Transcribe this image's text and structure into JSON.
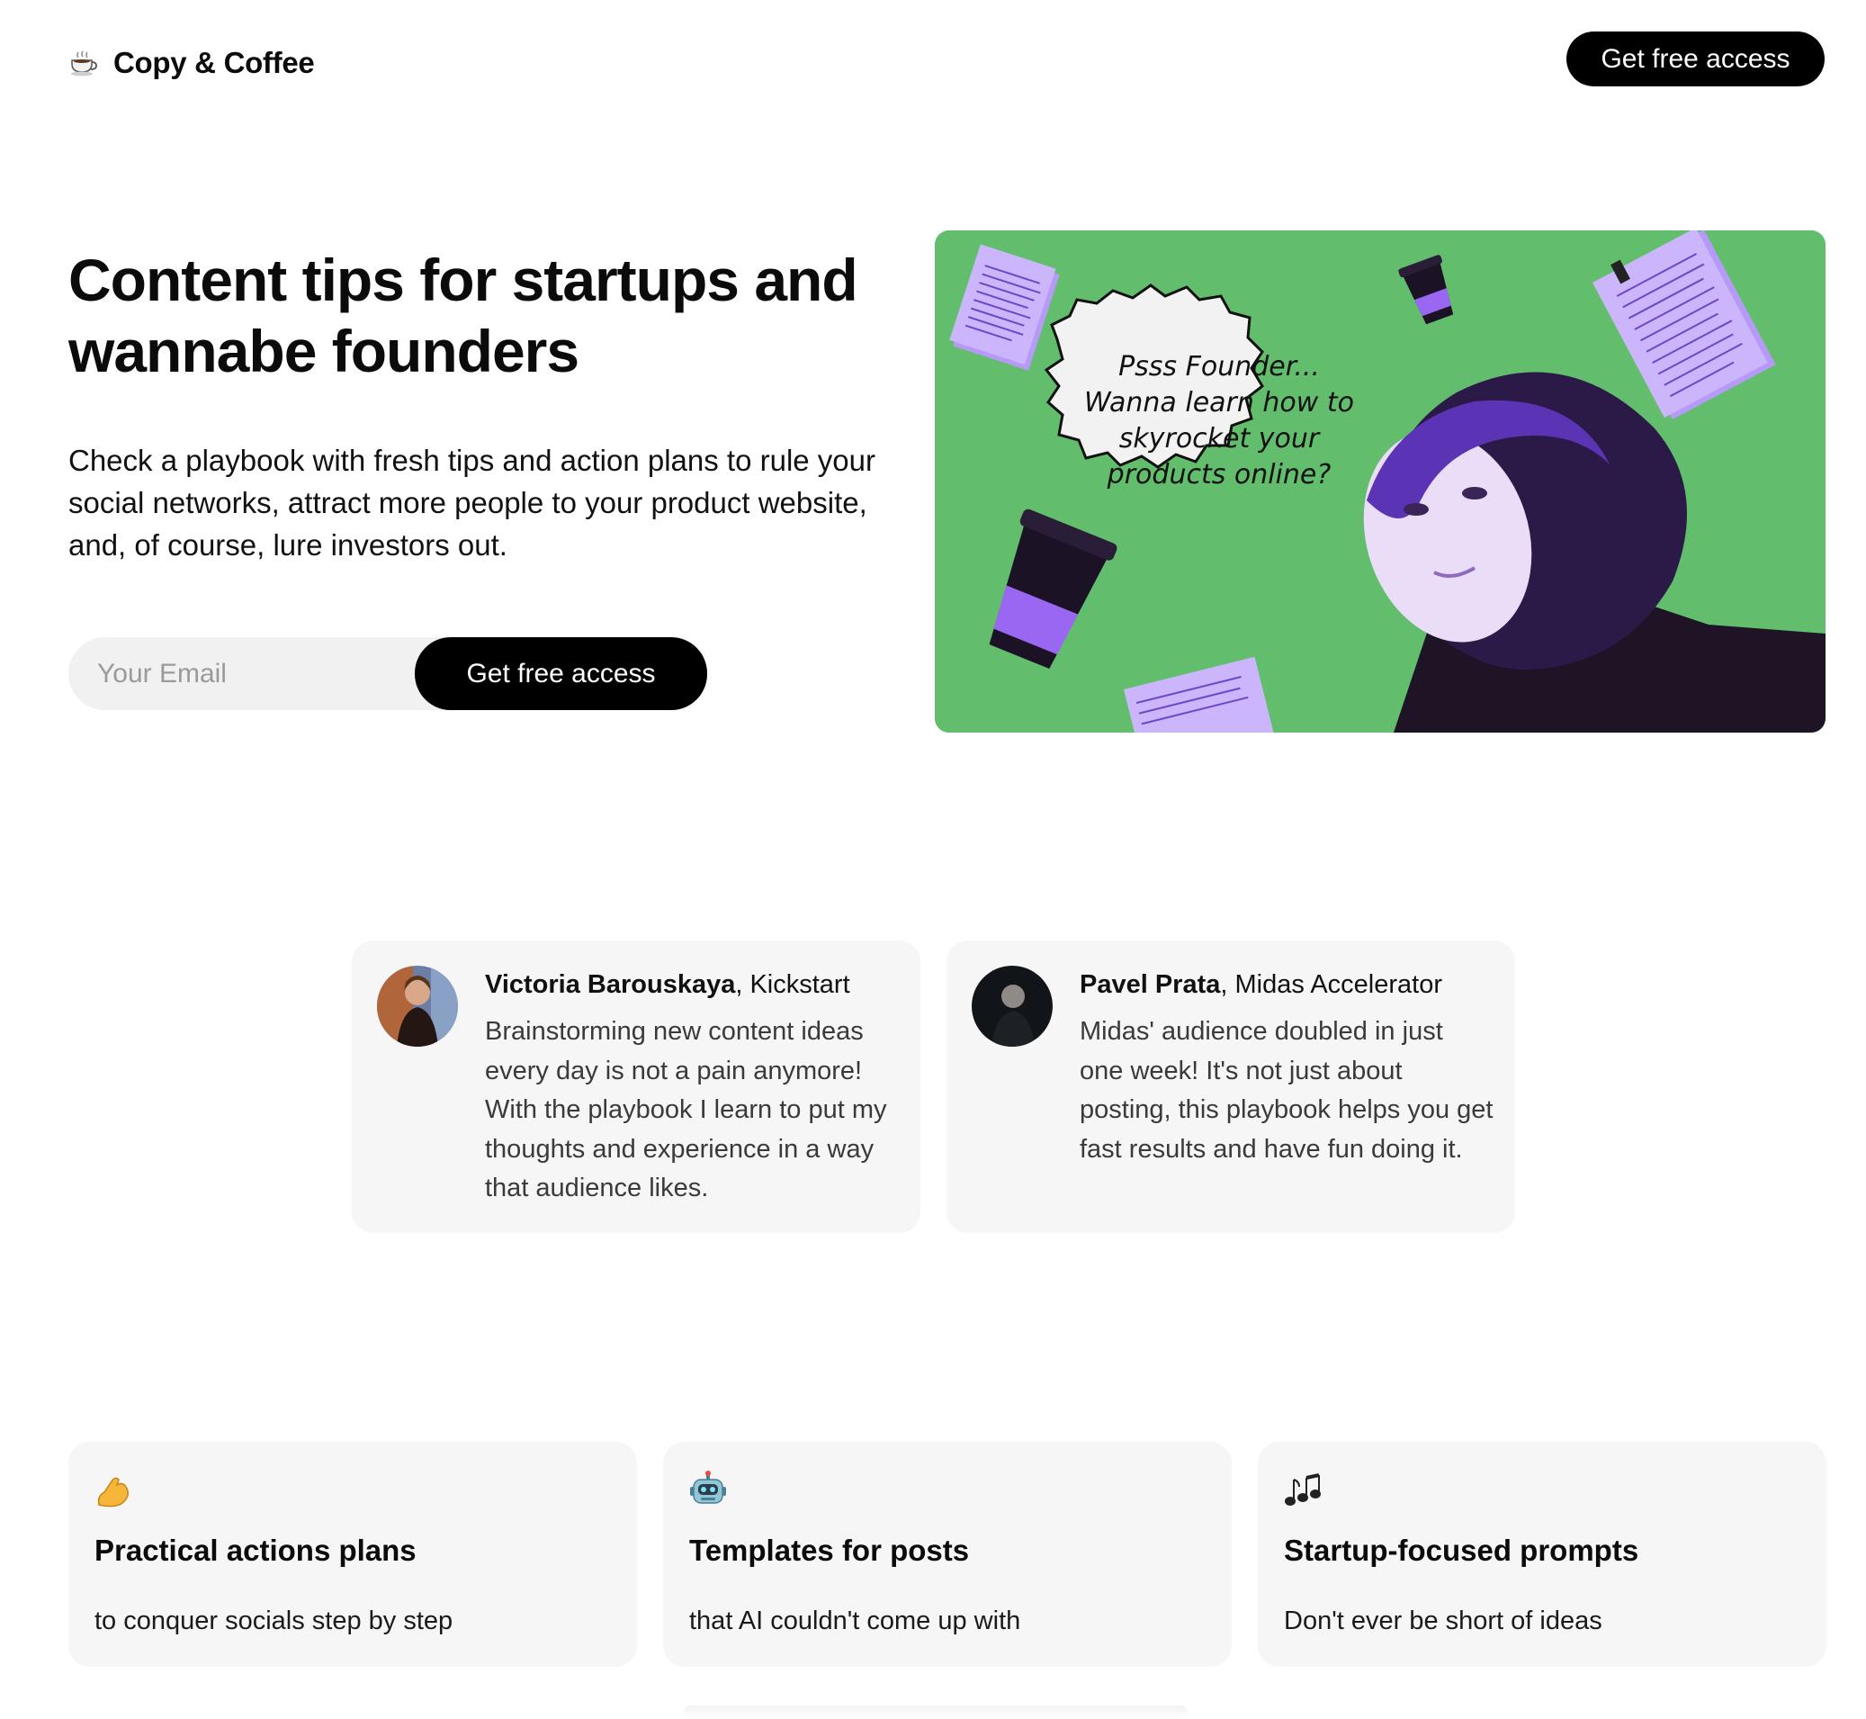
{
  "brand": {
    "name": "Copy & Coffee",
    "icon": "coffee-cup-icon"
  },
  "header": {
    "cta_label": "Get free access"
  },
  "hero": {
    "title": "Content tips for startups and wannabe founders",
    "description": "Check a playbook with fresh tips and action plans to rule your social networks, attract more people to your product website, and, of course, lure investors out.",
    "email_placeholder": "Your Email",
    "cta_label": "Get free access",
    "bubble_lines": [
      "Psss Founder...",
      "Wanna learn how to",
      "skyrocket your",
      "products online?"
    ],
    "colors": {
      "art_bg": "#62be6d",
      "accent": "#8a5cf5",
      "dark": "#1a1026"
    }
  },
  "testimonials": [
    {
      "name": "Victoria Barouskaya",
      "company": ", Kickstart",
      "quote": "Brainstorming new content ideas every day is not a pain anymore! With the playbook I learn to put my thoughts and experience in a way that audience likes."
    },
    {
      "name": "Pavel Prata",
      "company": ", Midas Accelerator",
      "quote": "Midas' audience doubled in just one week! It's not just about posting, this playbook helps you get fast results and have fun doing it."
    }
  ],
  "features": [
    {
      "icon": "flexed-biceps-icon",
      "title": "Practical actions plans",
      "subtitle": "to conquer socials step by step"
    },
    {
      "icon": "robot-icon",
      "title": "Templates for posts",
      "subtitle": "that AI couldn't come up with"
    },
    {
      "icon": "musical-notes-icon",
      "title": "Startup-focused prompts",
      "subtitle": "Don't ever be short of ideas"
    }
  ]
}
